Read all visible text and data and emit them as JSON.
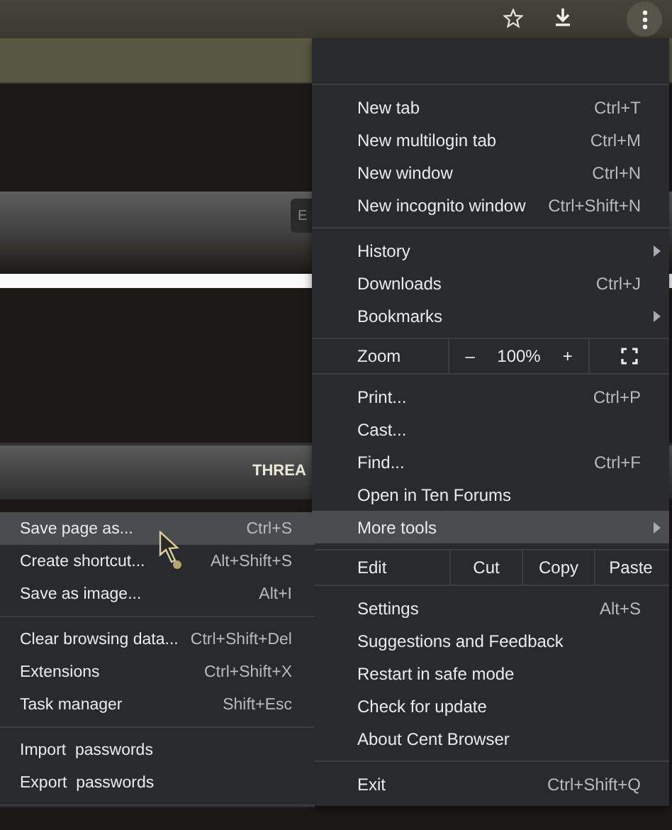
{
  "page": {
    "box_label": "E",
    "banner_text": "THREA"
  },
  "main_menu": {
    "sections": [
      [
        {
          "kind": "item",
          "label": "New tab",
          "shortcut": "Ctrl+T",
          "selected": false
        },
        {
          "kind": "item",
          "label": "New multilogin tab",
          "shortcut": "Ctrl+M",
          "selected": false
        },
        {
          "kind": "item",
          "label": "New window",
          "shortcut": "Ctrl+N",
          "selected": false
        },
        {
          "kind": "item",
          "label": "New incognito window",
          "shortcut": "Ctrl+Shift+N",
          "selected": false
        }
      ],
      [
        {
          "kind": "submenu",
          "label": "History",
          "selected": false
        },
        {
          "kind": "item",
          "label": "Downloads",
          "shortcut": "Ctrl+J",
          "selected": false
        },
        {
          "kind": "submenu",
          "label": "Bookmarks",
          "selected": false
        }
      ],
      [
        {
          "kind": "zoom",
          "label": "Zoom",
          "minus": "–",
          "value": "100%",
          "plus": "+"
        }
      ],
      [
        {
          "kind": "item",
          "label": "Print...",
          "shortcut": "Ctrl+P",
          "selected": false
        },
        {
          "kind": "item",
          "label": "Cast...",
          "selected": false
        },
        {
          "kind": "item",
          "label": "Find...",
          "shortcut": "Ctrl+F",
          "selected": false
        },
        {
          "kind": "item",
          "label": "Open in Ten Forums",
          "selected": false
        },
        {
          "kind": "submenu",
          "label": "More tools",
          "selected": true
        }
      ],
      [
        {
          "kind": "edit",
          "label": "Edit",
          "buttons": [
            "Cut",
            "Copy",
            "Paste"
          ]
        }
      ],
      [
        {
          "kind": "item",
          "label": "Settings",
          "shortcut": "Alt+S",
          "selected": false
        },
        {
          "kind": "item",
          "label": "Suggestions and Feedback",
          "selected": false
        },
        {
          "kind": "item",
          "label": "Restart in safe mode",
          "selected": false
        },
        {
          "kind": "item",
          "label": "Check for update",
          "selected": false
        },
        {
          "kind": "item",
          "label": "About Cent Browser",
          "selected": false
        }
      ],
      [
        {
          "kind": "item",
          "label": "Exit",
          "shortcut": "Ctrl+Shift+Q",
          "selected": false
        }
      ]
    ]
  },
  "more_tools_menu": {
    "sections": [
      [
        {
          "label": "Save page as...",
          "shortcut": "Ctrl+S",
          "selected": true
        },
        {
          "label": "Create shortcut...",
          "shortcut": "Alt+Shift+S",
          "selected": false
        },
        {
          "label": "Save as image...",
          "shortcut": "Alt+I",
          "selected": false
        }
      ],
      [
        {
          "label": "Clear browsing data...",
          "shortcut": "Ctrl+Shift+Del",
          "selected": false
        },
        {
          "label": "Extensions",
          "shortcut": "Ctrl+Shift+X",
          "selected": false
        },
        {
          "label": "Task manager",
          "shortcut": "Shift+Esc",
          "selected": false
        }
      ],
      [
        {
          "label": "Import  passwords",
          "selected": false
        },
        {
          "label": "Export  passwords",
          "selected": false
        }
      ]
    ]
  }
}
